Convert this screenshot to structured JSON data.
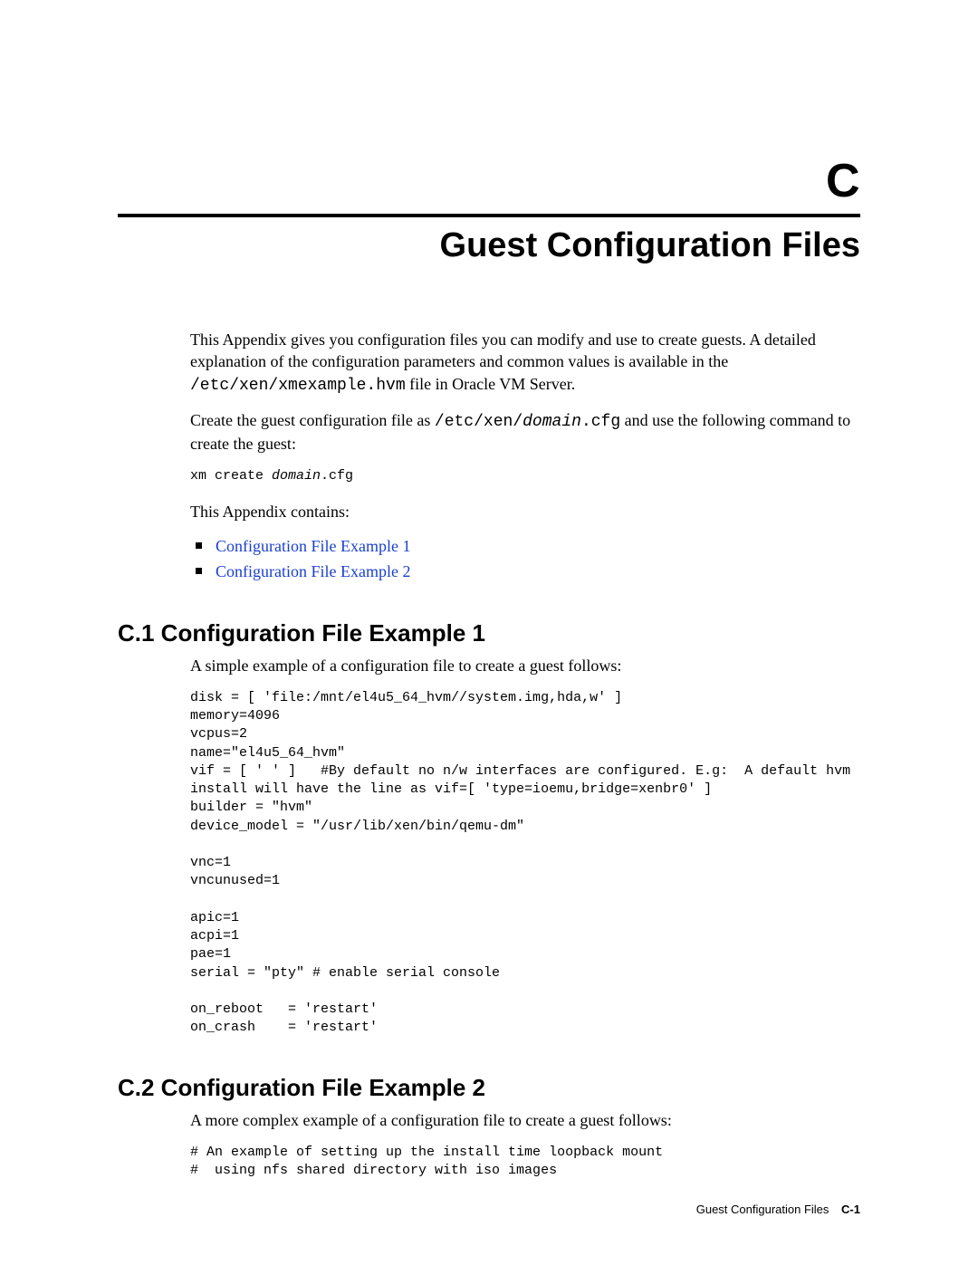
{
  "header": {
    "appendix_letter": "C",
    "title": "Guest Configuration Files"
  },
  "intro": {
    "p1_pre": "This Appendix gives you configuration files you can modify and use to create guests. A detailed explanation of the configuration parameters and common values is available in the ",
    "p1_path": "/etc/xen/xmexample.hvm",
    "p1_post": " file in Oracle VM Server.",
    "p2_pre": "Create the guest configuration file as ",
    "p2_path_a": "/etc/xen/",
    "p2_domain": "domain",
    "p2_path_b": ".cfg",
    "p2_post": " and use the following command to create the guest:",
    "cmd_pre": "xm create ",
    "cmd_domain": "domain",
    "cmd_post": ".cfg",
    "contains_label": "This Appendix contains:"
  },
  "toc": {
    "items": [
      {
        "label": "Configuration File Example 1"
      },
      {
        "label": "Configuration File Example 2"
      }
    ]
  },
  "sections": {
    "s1": {
      "heading": "C.1  Configuration File Example 1",
      "lead": "A simple example of a configuration file to create a guest follows:",
      "code": "disk = [ 'file:/mnt/el4u5_64_hvm//system.img,hda,w' ]\nmemory=4096\nvcpus=2\nname=\"el4u5_64_hvm\"\nvif = [ ' ' ]   #By default no n/w interfaces are configured. E.g:  A default hvm install will have the line as vif=[ 'type=ioemu,bridge=xenbr0' ]\nbuilder = \"hvm\"\ndevice_model = \"/usr/lib/xen/bin/qemu-dm\"\n\nvnc=1\nvncunused=1\n\napic=1\nacpi=1\npae=1\nserial = \"pty\" # enable serial console\n\non_reboot   = 'restart'\non_crash    = 'restart'"
    },
    "s2": {
      "heading": "C.2  Configuration File Example 2",
      "lead": "A more complex example of a configuration file to create a guest follows:",
      "code": "# An example of setting up the install time loopback mount\n#  using nfs shared directory with iso images"
    }
  },
  "footer": {
    "title": "Guest Configuration Files",
    "page": "C-1"
  }
}
